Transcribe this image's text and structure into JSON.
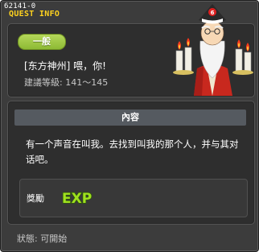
{
  "window": {
    "quest_id": "62141-0",
    "title": "QUEST INFO"
  },
  "quest": {
    "category": "一般",
    "title": "[东方神州] 喂，你!",
    "level": "建議等級: 141～145"
  },
  "content": {
    "section_header": "內容",
    "description": "有一个声音在叫我。去找到叫我的那个人，并与其对话吧。"
  },
  "reward": {
    "label": "獎勵",
    "exp_text": "EXP"
  },
  "status": "狀態: 可開始",
  "colors": {
    "window_bg": "#3c3c3c",
    "panel_bg": "#2e2e2e",
    "title_accent": "#ffd21e",
    "badge_green": "#9ac846",
    "exp_green": "#a0e020"
  },
  "icons": {
    "npc": "old-sage-npc-portrait",
    "reward": "exp-icon"
  }
}
